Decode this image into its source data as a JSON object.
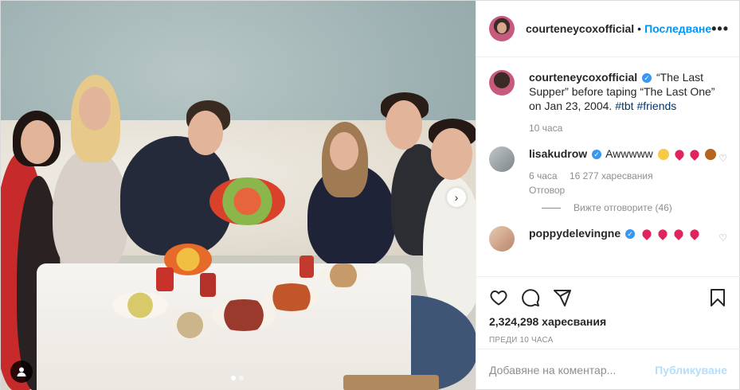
{
  "header": {
    "username": "courteneycoxofficial",
    "separator": "•",
    "follow_label": "Последване",
    "more_label": "•••"
  },
  "caption": {
    "username": "courteneycoxofficial",
    "text": "“The Last Supper” before taping “The Last One” on Jan 23, 2004. ",
    "hashtags": [
      "#tbt",
      "#friends"
    ],
    "time": "10 часа"
  },
  "comments": [
    {
      "username": "lisakudrow",
      "text": "Awwwww",
      "emojis": [
        "smiling-face-emoji",
        "heart-emoji",
        "heart-emoji",
        "pie-emoji"
      ],
      "time": "6 часа",
      "likes": "16 277 харесвания",
      "reply_label": "Отговор",
      "view_replies": "Вижте отговорите (46)"
    },
    {
      "username": "poppydelevingne",
      "text": "",
      "emojis": [
        "heart-emoji",
        "heart-emoji",
        "heart-emoji",
        "heart-emoji"
      ]
    }
  ],
  "actions": {
    "likes": "2,324,298 харесвания",
    "posted": "ПРЕДИ 10 ЧАСА"
  },
  "add_comment": {
    "placeholder": "Добавяне на коментар...",
    "post_label": "Публикуване"
  },
  "colors": {
    "link": "#0095f6",
    "hashtag": "#00376b",
    "muted": "#8e8e8e",
    "post_disabled": "#b2dffc",
    "verified": "#3897f0"
  },
  "icons": {
    "heart": "heart-icon",
    "comment": "comment-icon",
    "share": "share-icon",
    "bookmark": "bookmark-icon",
    "user_tag": "user-tag-icon",
    "next": "chevron-right-icon"
  },
  "carousel": {
    "count": 2,
    "active": 1
  }
}
